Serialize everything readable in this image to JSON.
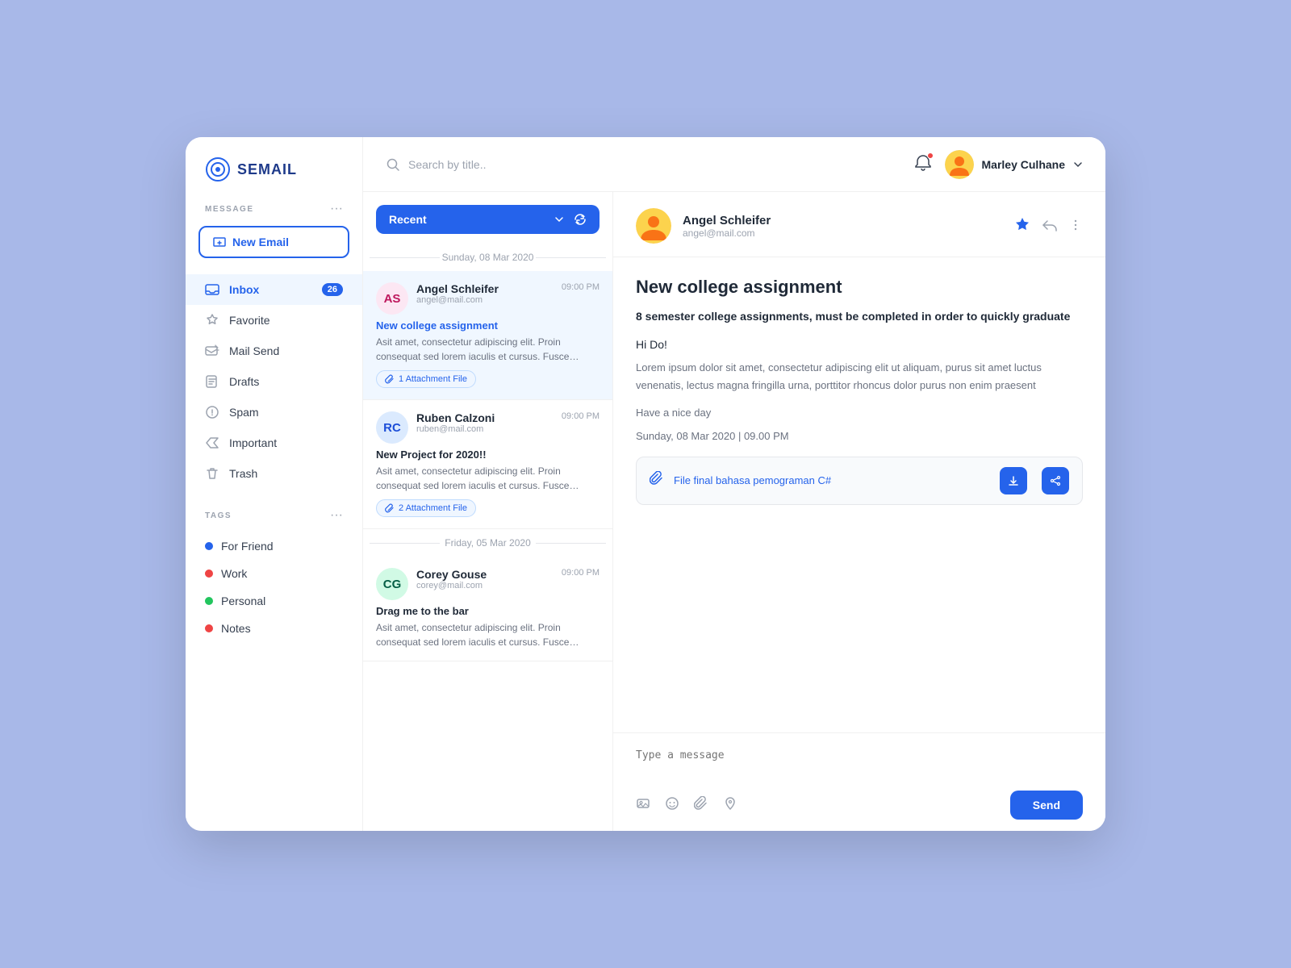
{
  "app": {
    "name": "SEMAIL"
  },
  "sidebar": {
    "section_label": "MESSAGE",
    "new_email_label": "New Email",
    "nav_items": [
      {
        "id": "inbox",
        "label": "Inbox",
        "badge": "26",
        "active": true
      },
      {
        "id": "favorite",
        "label": "Favorite",
        "badge": null
      },
      {
        "id": "mail-send",
        "label": "Mail Send",
        "badge": null
      },
      {
        "id": "drafts",
        "label": "Drafts",
        "badge": null
      },
      {
        "id": "spam",
        "label": "Spam",
        "badge": null
      },
      {
        "id": "important",
        "label": "Important",
        "badge": null
      },
      {
        "id": "trash",
        "label": "Trash",
        "badge": null
      }
    ],
    "tags_label": "TAGS",
    "tags": [
      {
        "id": "for-friend",
        "label": "For Friend",
        "color": "#2563eb"
      },
      {
        "id": "work",
        "label": "Work",
        "color": "#ef4444"
      },
      {
        "id": "personal",
        "label": "Personal",
        "color": "#22c55e"
      },
      {
        "id": "notes",
        "label": "Notes",
        "color": "#ef4444"
      }
    ]
  },
  "topbar": {
    "search_placeholder": "Search by title..",
    "user_name": "Marley Culhane"
  },
  "email_list": {
    "filter_label": "Recent",
    "date_groups": [
      {
        "date": "Sunday, 08 Mar 2020",
        "emails": [
          {
            "id": "email-1",
            "sender_name": "Angel Schleifer",
            "sender_email": "angel@mail.com",
            "time": "09:00 PM",
            "subject": "New college assignment",
            "subject_color": "blue",
            "preview": "Asit amet, consectetur adipiscing elit. Proin consequat sed lorem iaculis et cursus. Fusce rhoncus massa nibh fringilla.",
            "attachment": "1 Attachment File",
            "active": true,
            "avatar_initials": "AS",
            "avatar_color": "#fce7f3"
          },
          {
            "id": "email-2",
            "sender_name": "Ruben Calzoni",
            "sender_email": "ruben@mail.com",
            "time": "09:00 PM",
            "subject": "New Project for 2020!!",
            "subject_color": "black",
            "preview": "Asit amet, consectetur adipiscing elit. Proin consequat sed lorem iaculis et cursus. Fusce rhoncus massa nibh fringilla.",
            "attachment": "2 Attachment File",
            "active": false,
            "avatar_initials": "RC",
            "avatar_color": "#dbeafe"
          }
        ]
      },
      {
        "date": "Friday, 05 Mar 2020",
        "emails": [
          {
            "id": "email-3",
            "sender_name": "Corey Gouse",
            "sender_email": "corey@mail.com",
            "time": "09:00 PM",
            "subject": "Drag me to the bar",
            "subject_color": "black",
            "preview": "Asit amet, consectetur adipiscing elit. Proin consequat sed lorem iaculis et cursus. Fusce rhoncus massa nibh fringilla.",
            "attachment": null,
            "active": false,
            "avatar_initials": "CG",
            "avatar_color": "#d1fae5"
          }
        ]
      }
    ]
  },
  "email_detail": {
    "sender_name": "Angel Schleifer",
    "sender_email": "angel@mail.com",
    "subject": "New college assignment",
    "bold_summary": "8 semester college assignments, must be completed in order to quickly graduate",
    "greeting": "Hi Do!",
    "body": "Lorem ipsum dolor sit amet, consectetur adipiscing elit ut aliquam, purus sit amet luctus venenatis, lectus magna fringilla urna, porttitor rhoncus dolor purus non enim praesent",
    "sign_off": "Have a nice day",
    "datetime": "Sunday, 08 Mar 2020 | 09.00 PM",
    "attachment_name": "File final bahasa pemograman C#",
    "reply_placeholder": "Type a message",
    "send_label": "Send"
  }
}
